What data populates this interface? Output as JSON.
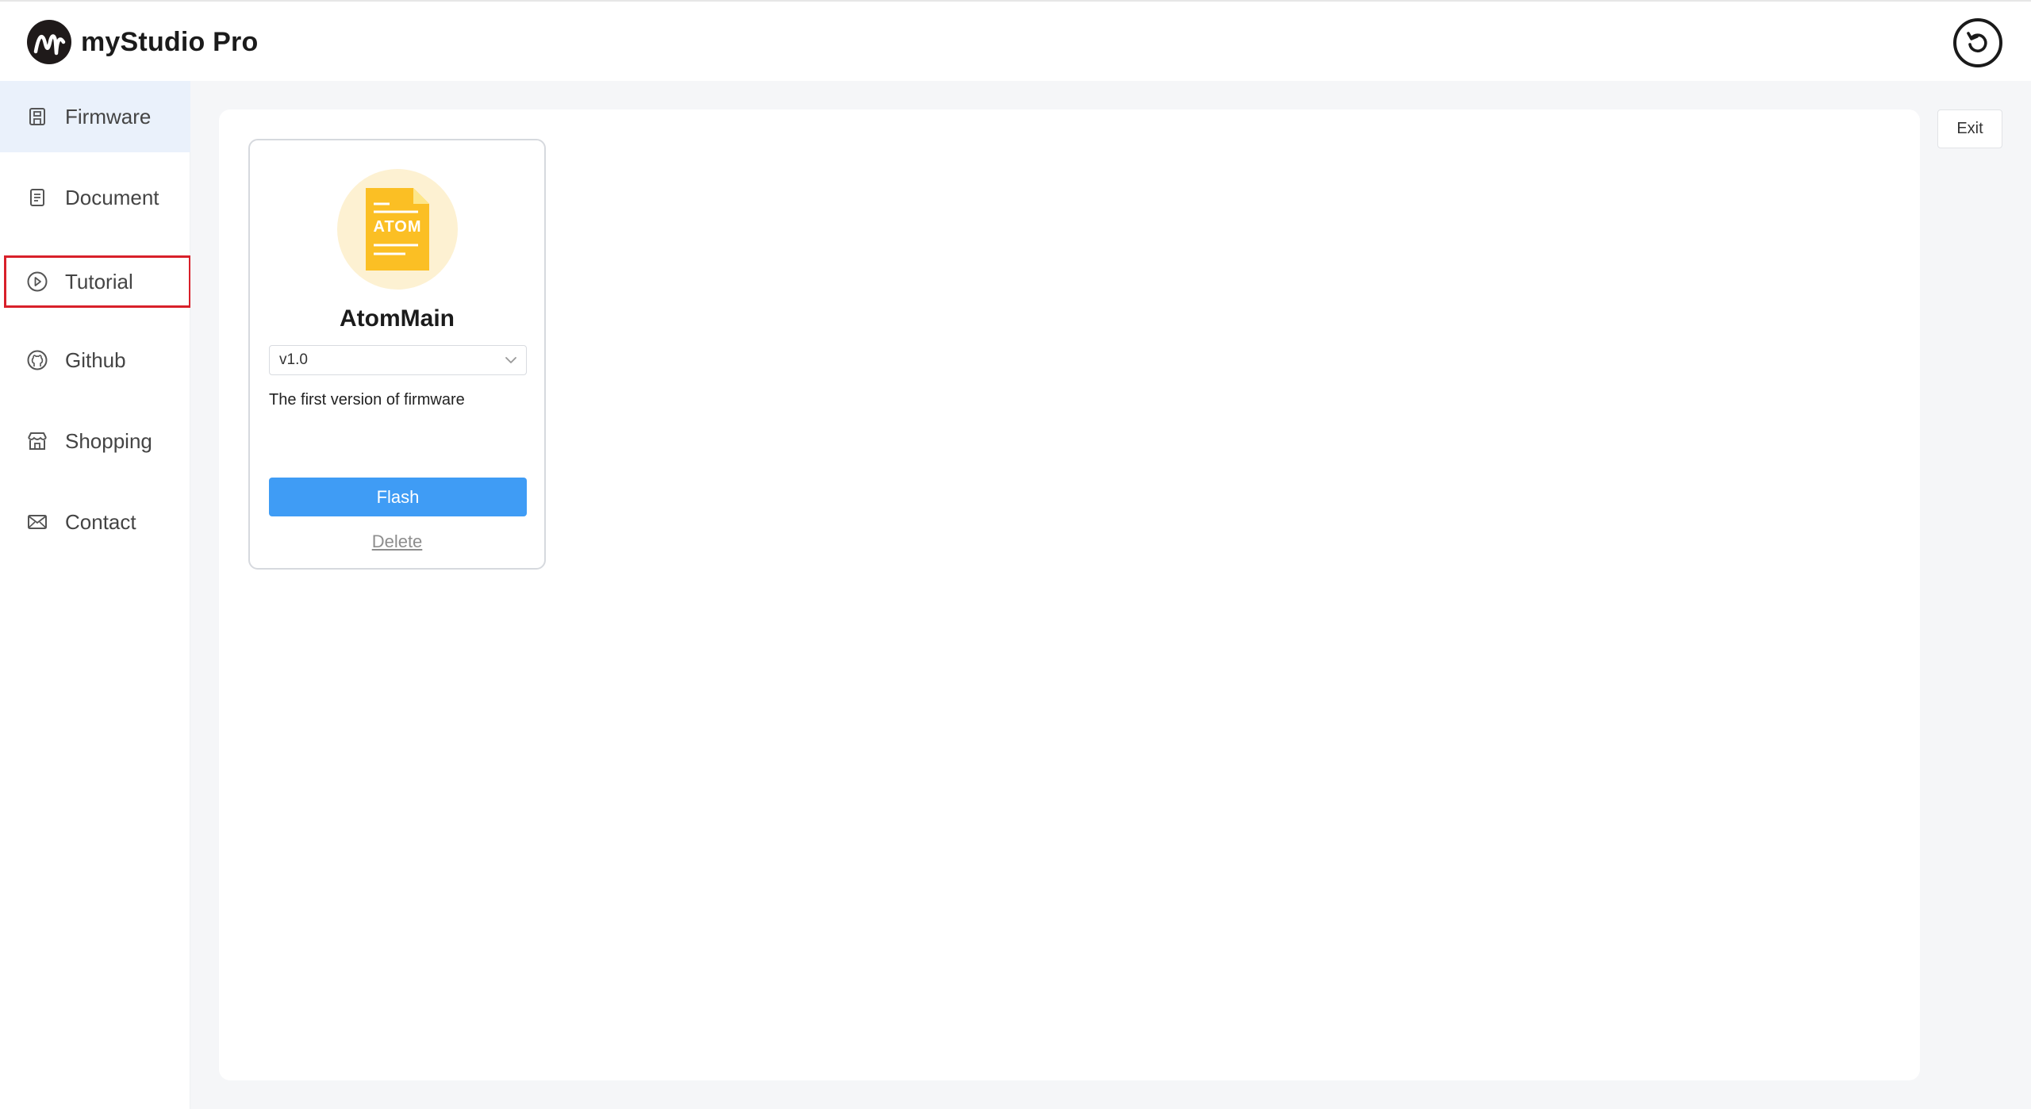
{
  "app": {
    "title": "myStudio Pro"
  },
  "sidebar": {
    "items": [
      {
        "label": "Firmware",
        "icon": "firmware-icon"
      },
      {
        "label": "Document",
        "icon": "document-icon"
      },
      {
        "label": "Tutorial",
        "icon": "play-circle-icon"
      },
      {
        "label": "Github",
        "icon": "github-icon"
      },
      {
        "label": "Shopping",
        "icon": "shop-icon"
      },
      {
        "label": "Contact",
        "icon": "mail-icon"
      }
    ]
  },
  "firmware_card": {
    "icon_text": "ATOM",
    "title": "AtomMain",
    "version": "v1.0",
    "description": "The first version of firmware",
    "flash_label": "Flash",
    "delete_label": "Delete"
  },
  "header": {
    "exit_label": "Exit"
  },
  "colors": {
    "accent": "#3f9cf5",
    "active_nav_bg": "#eaf1fb",
    "highlight_border": "#d8202a",
    "file_icon": "#fbbf24"
  }
}
